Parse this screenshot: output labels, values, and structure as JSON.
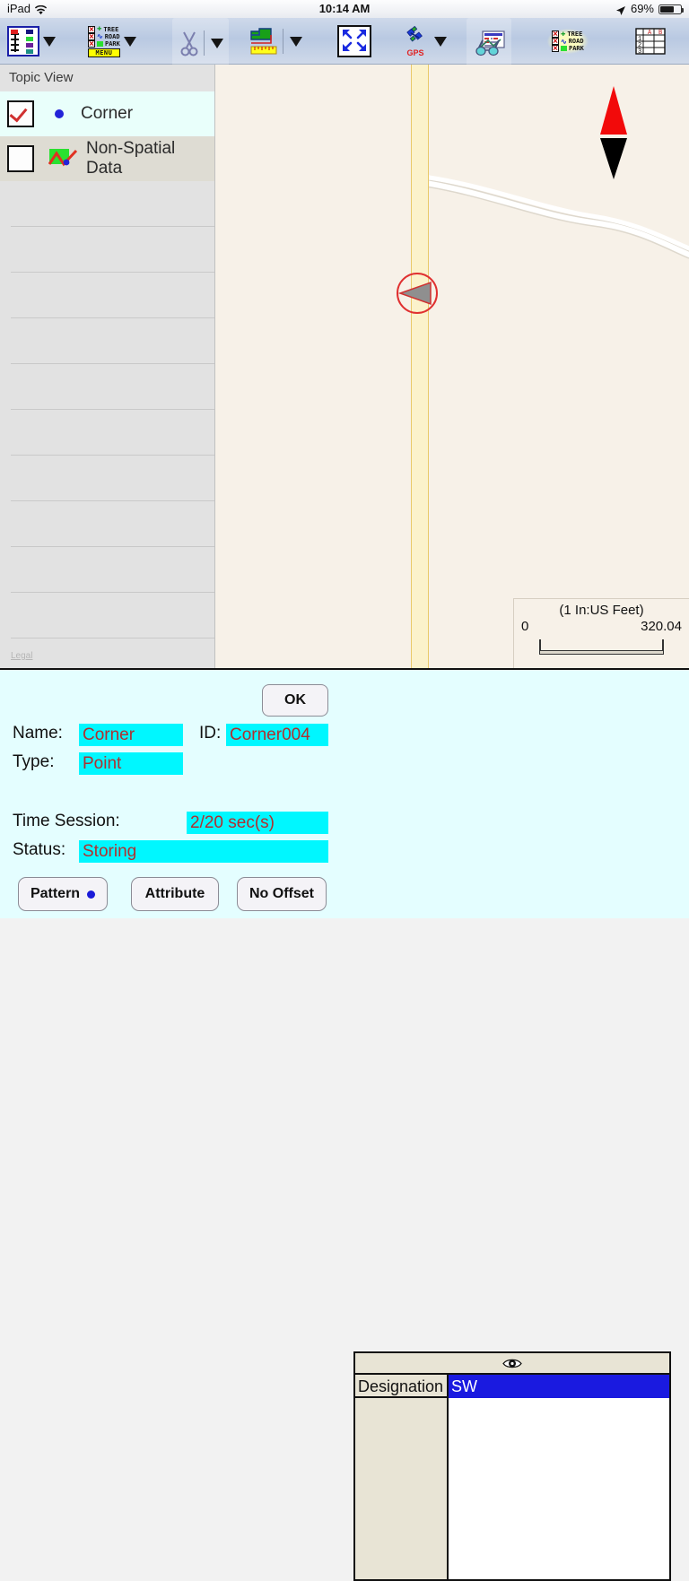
{
  "status_bar": {
    "device": "iPad",
    "wifi_icon": "wifi-icon",
    "time": "10:14 AM",
    "location_icon": "location-arrow-icon",
    "battery_percent": "69%",
    "battery_icon": "battery-icon"
  },
  "toolbar": {
    "items": [
      {
        "name": "topic-list",
        "icon": "topic-list-icon",
        "has_caret": true
      },
      {
        "name": "layer-menu",
        "icon": "layer-legend-icon",
        "label": "MENU",
        "legend": [
          "TREE",
          "ROAD",
          "PARK"
        ],
        "has_caret": true
      },
      {
        "name": "cut-tool",
        "icon": "scissors-icon",
        "has_caret": true
      },
      {
        "name": "measure-tool",
        "icon": "map-ruler-icon",
        "has_caret": true
      },
      {
        "name": "zoom-extent",
        "icon": "expand-arrows-icon",
        "has_caret": false
      },
      {
        "name": "gps-tool",
        "icon": "gps-satellite-icon",
        "label": "GPS",
        "has_caret": true
      },
      {
        "name": "report-tool",
        "icon": "report-binoculars-icon",
        "has_caret": false
      },
      {
        "name": "layer-visibility",
        "icon": "layer-legend-icon",
        "legend": [
          "TREE",
          "ROAD",
          "PARK"
        ],
        "has_caret": false
      },
      {
        "name": "attribute-table",
        "icon": "grid-table-icon",
        "has_caret": false
      }
    ],
    "legend_rows": [
      "TREE",
      "ROAD",
      "PARK"
    ],
    "menu_label": "MENU",
    "gps_label": "GPS",
    "grid_cols": [
      "A",
      "B"
    ],
    "grid_rows": [
      "1",
      "2",
      "3"
    ]
  },
  "sidebar": {
    "title": "Topic View",
    "legal_link": "Legal",
    "topics": [
      {
        "label": "Corner",
        "checked": true,
        "symbol": "point-dot-symbol",
        "selected": true
      },
      {
        "label": "Non-Spatial Data",
        "checked": false,
        "symbol": "chart-symbol",
        "selected": false
      }
    ]
  },
  "map": {
    "north_arrow_icon": "north-arrow-icon",
    "gps_cursor_icon": "gps-cursor-icon",
    "scale": {
      "title": "(1 In:US Feet)",
      "min": "0",
      "max": "320.04"
    }
  },
  "form": {
    "ok_label": "OK",
    "name_label": "Name:",
    "name_value": "Corner",
    "id_label": "ID:",
    "id_value": "Corner004",
    "type_label": "Type:",
    "type_value": "Point",
    "time_session_label": "Time Session:",
    "time_session_value": "2/20 sec(s)",
    "status_label": "Status:",
    "status_value": "Storing",
    "pattern_label": "Pattern",
    "attribute_label": "Attribute",
    "no_offset_label": "No Offset"
  },
  "attribute_table": {
    "eye_icon": "eye-icon",
    "rows": [
      {
        "field": "Designation",
        "value": "SW",
        "selected": true
      },
      {
        "field": "",
        "value": "",
        "selected": false
      },
      {
        "field": "",
        "value": "",
        "selected": false
      },
      {
        "field": "",
        "value": "",
        "selected": false
      },
      {
        "field": "",
        "value": "",
        "selected": false
      },
      {
        "field": "",
        "value": "",
        "selected": false
      },
      {
        "field": "",
        "value": "",
        "selected": false
      },
      {
        "field": "",
        "value": "",
        "selected": false
      }
    ]
  },
  "colors": {
    "toolbar_bg": "#c3cfe4",
    "map_bg": "#f7f1e8",
    "road_yellow": "#fbf2cb",
    "field_cyan": "#00f7ff",
    "field_text": "#b03030",
    "selection_blue": "#1a1ae0",
    "panel_cyan": "#e4feff",
    "table_beige": "#e8e4d5"
  }
}
